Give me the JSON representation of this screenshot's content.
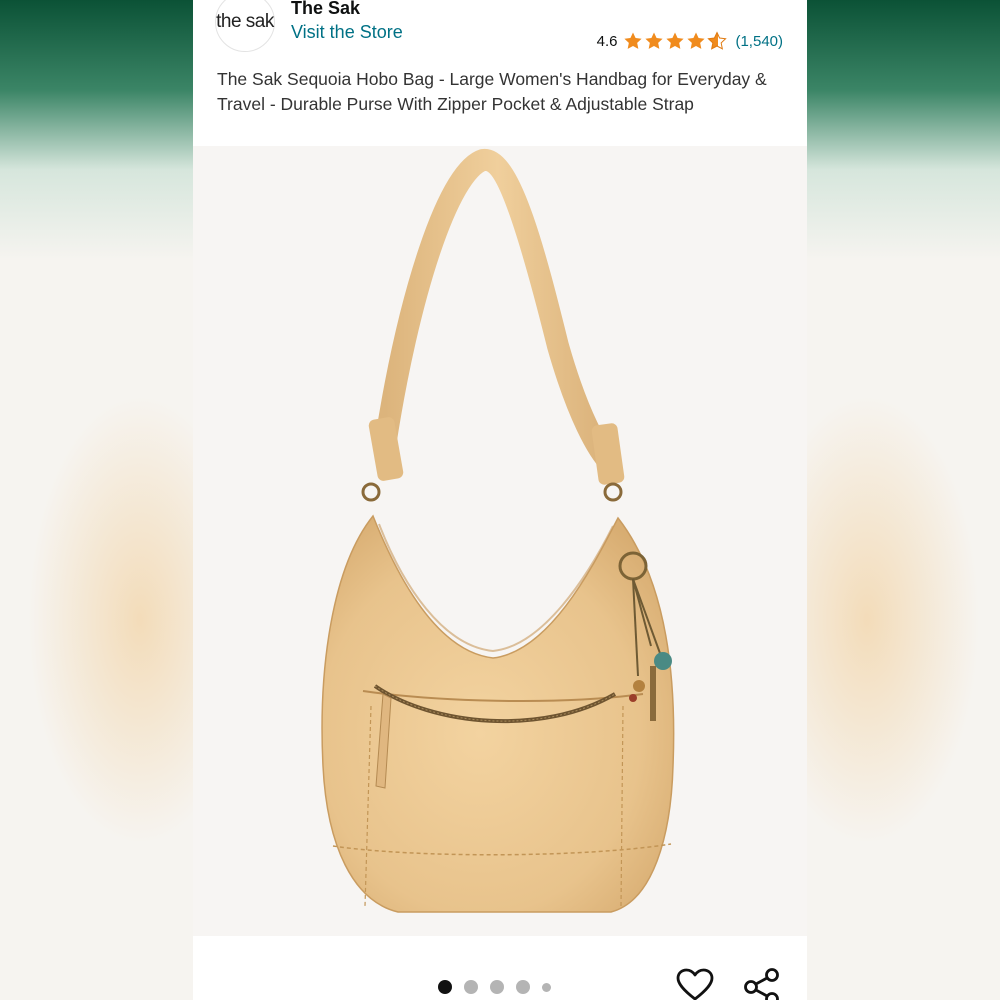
{
  "brand": {
    "logo_text": "the sak",
    "name": "The Sak",
    "store_link": "Visit the Store"
  },
  "rating": {
    "value": "4.6",
    "stars": 4.6,
    "count": "(1,540)",
    "star_color": "#f3a847"
  },
  "product": {
    "title": "The Sak Sequoia Hobo Bag - Large Women's Handbag for Everyday & Travel - Durable Purse With Zipper Pocket & Adjustable Strap",
    "image_description_icon": "product-image"
  },
  "gallery": {
    "total_images": 5,
    "active_index": 0
  },
  "actions": {
    "favorite_icon": "heart-icon",
    "share_icon": "share-icon"
  },
  "colors": {
    "link": "#007185",
    "text": "#0f1111",
    "bag": "#e9c48c"
  }
}
